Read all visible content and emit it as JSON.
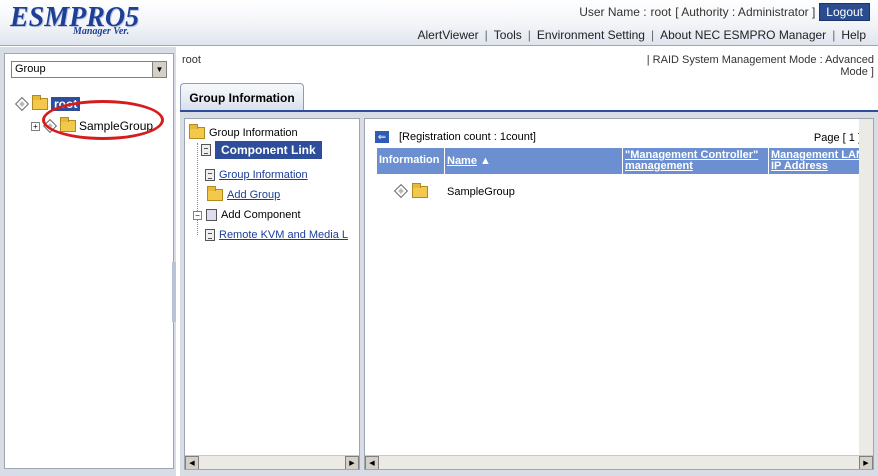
{
  "header": {
    "logo_text": "ESMPRO5",
    "logo_sub": "Manager Ver.",
    "user_label": "User Name :",
    "user_name": "root",
    "authority_text": "[ Authority : Administrator ]",
    "logout_label": "Logout",
    "menu": [
      "AlertViewer",
      "Tools",
      "Environment Setting",
      "About NEC ESMPRO Manager",
      "Help"
    ]
  },
  "left": {
    "select_value": "Group",
    "tree": {
      "root_label": "root",
      "child_label": "SampleGroup"
    }
  },
  "breadcrumb": "root",
  "mode_text": "| RAID System Management Mode : Advanced Mode ]",
  "tabs": [
    {
      "label": "Group Information"
    }
  ],
  "nav": {
    "title": "Group Information",
    "items": [
      {
        "label": "Component Link"
      },
      {
        "label": "Group Information"
      },
      {
        "label": "Add Group"
      }
    ],
    "add_component": "Add Component",
    "sub_item": "Remote KVM and Media L"
  },
  "main": {
    "registration": "[Registration count : 1count]",
    "page": "Page [  1  ]",
    "columns": [
      "Information",
      "Name",
      "\"Management Controller\" management",
      "Management LAN IP Address"
    ],
    "rows": [
      {
        "name": "SampleGroup"
      }
    ]
  },
  "colors": {
    "accent": "#2e4e9c",
    "table_header": "#6b8fd0",
    "annotation": "#d61c1c"
  }
}
